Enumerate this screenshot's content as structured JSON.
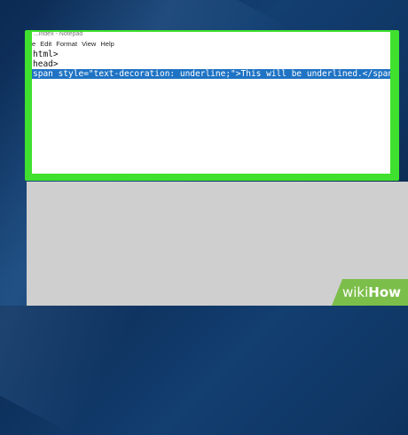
{
  "window": {
    "title": "...index - Notepad"
  },
  "menu": {
    "items": [
      "e",
      "Edit",
      "Format",
      "View",
      "Help"
    ]
  },
  "document": {
    "lines": [
      "html>",
      "head>",
      "span style=\"text-decoration: underline;\">This will be underlined.</span>"
    ],
    "selected_line_index": 2
  },
  "colors": {
    "highlight_frame": "#3fe02e",
    "selection": "#1f73c4",
    "watermark": "#7cbe4a"
  },
  "watermark": {
    "wiki": "wiki",
    "how": "How"
  }
}
